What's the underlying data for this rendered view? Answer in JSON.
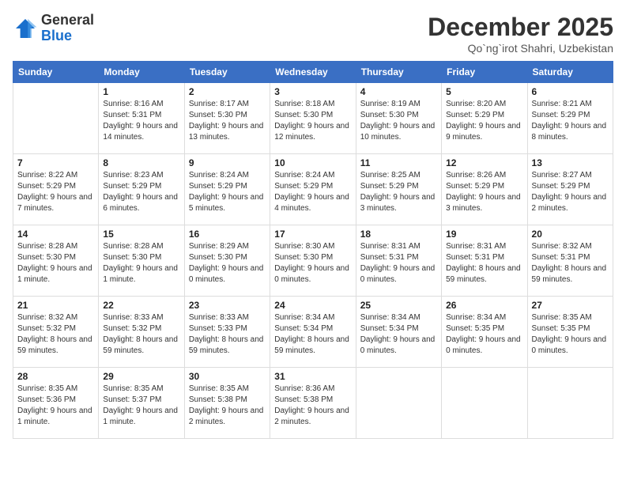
{
  "logo": {
    "general": "General",
    "blue": "Blue"
  },
  "header": {
    "month_year": "December 2025",
    "location": "Qo`ng`irot Shahri, Uzbekistan"
  },
  "weekdays": [
    "Sunday",
    "Monday",
    "Tuesday",
    "Wednesday",
    "Thursday",
    "Friday",
    "Saturday"
  ],
  "weeks": [
    [
      {
        "day": "",
        "sunrise": "",
        "sunset": "",
        "daylight": "",
        "empty": true
      },
      {
        "day": "1",
        "sunrise": "Sunrise: 8:16 AM",
        "sunset": "Sunset: 5:31 PM",
        "daylight": "Daylight: 9 hours and 14 minutes."
      },
      {
        "day": "2",
        "sunrise": "Sunrise: 8:17 AM",
        "sunset": "Sunset: 5:30 PM",
        "daylight": "Daylight: 9 hours and 13 minutes."
      },
      {
        "day": "3",
        "sunrise": "Sunrise: 8:18 AM",
        "sunset": "Sunset: 5:30 PM",
        "daylight": "Daylight: 9 hours and 12 minutes."
      },
      {
        "day": "4",
        "sunrise": "Sunrise: 8:19 AM",
        "sunset": "Sunset: 5:30 PM",
        "daylight": "Daylight: 9 hours and 10 minutes."
      },
      {
        "day": "5",
        "sunrise": "Sunrise: 8:20 AM",
        "sunset": "Sunset: 5:29 PM",
        "daylight": "Daylight: 9 hours and 9 minutes."
      },
      {
        "day": "6",
        "sunrise": "Sunrise: 8:21 AM",
        "sunset": "Sunset: 5:29 PM",
        "daylight": "Daylight: 9 hours and 8 minutes."
      }
    ],
    [
      {
        "day": "7",
        "sunrise": "Sunrise: 8:22 AM",
        "sunset": "Sunset: 5:29 PM",
        "daylight": "Daylight: 9 hours and 7 minutes."
      },
      {
        "day": "8",
        "sunrise": "Sunrise: 8:23 AM",
        "sunset": "Sunset: 5:29 PM",
        "daylight": "Daylight: 9 hours and 6 minutes."
      },
      {
        "day": "9",
        "sunrise": "Sunrise: 8:24 AM",
        "sunset": "Sunset: 5:29 PM",
        "daylight": "Daylight: 9 hours and 5 minutes."
      },
      {
        "day": "10",
        "sunrise": "Sunrise: 8:24 AM",
        "sunset": "Sunset: 5:29 PM",
        "daylight": "Daylight: 9 hours and 4 minutes."
      },
      {
        "day": "11",
        "sunrise": "Sunrise: 8:25 AM",
        "sunset": "Sunset: 5:29 PM",
        "daylight": "Daylight: 9 hours and 3 minutes."
      },
      {
        "day": "12",
        "sunrise": "Sunrise: 8:26 AM",
        "sunset": "Sunset: 5:29 PM",
        "daylight": "Daylight: 9 hours and 3 minutes."
      },
      {
        "day": "13",
        "sunrise": "Sunrise: 8:27 AM",
        "sunset": "Sunset: 5:29 PM",
        "daylight": "Daylight: 9 hours and 2 minutes."
      }
    ],
    [
      {
        "day": "14",
        "sunrise": "Sunrise: 8:28 AM",
        "sunset": "Sunset: 5:30 PM",
        "daylight": "Daylight: 9 hours and 1 minute."
      },
      {
        "day": "15",
        "sunrise": "Sunrise: 8:28 AM",
        "sunset": "Sunset: 5:30 PM",
        "daylight": "Daylight: 9 hours and 1 minute."
      },
      {
        "day": "16",
        "sunrise": "Sunrise: 8:29 AM",
        "sunset": "Sunset: 5:30 PM",
        "daylight": "Daylight: 9 hours and 0 minutes."
      },
      {
        "day": "17",
        "sunrise": "Sunrise: 8:30 AM",
        "sunset": "Sunset: 5:30 PM",
        "daylight": "Daylight: 9 hours and 0 minutes."
      },
      {
        "day": "18",
        "sunrise": "Sunrise: 8:31 AM",
        "sunset": "Sunset: 5:31 PM",
        "daylight": "Daylight: 9 hours and 0 minutes."
      },
      {
        "day": "19",
        "sunrise": "Sunrise: 8:31 AM",
        "sunset": "Sunset: 5:31 PM",
        "daylight": "Daylight: 8 hours and 59 minutes."
      },
      {
        "day": "20",
        "sunrise": "Sunrise: 8:32 AM",
        "sunset": "Sunset: 5:31 PM",
        "daylight": "Daylight: 8 hours and 59 minutes."
      }
    ],
    [
      {
        "day": "21",
        "sunrise": "Sunrise: 8:32 AM",
        "sunset": "Sunset: 5:32 PM",
        "daylight": "Daylight: 8 hours and 59 minutes."
      },
      {
        "day": "22",
        "sunrise": "Sunrise: 8:33 AM",
        "sunset": "Sunset: 5:32 PM",
        "daylight": "Daylight: 8 hours and 59 minutes."
      },
      {
        "day": "23",
        "sunrise": "Sunrise: 8:33 AM",
        "sunset": "Sunset: 5:33 PM",
        "daylight": "Daylight: 8 hours and 59 minutes."
      },
      {
        "day": "24",
        "sunrise": "Sunrise: 8:34 AM",
        "sunset": "Sunset: 5:34 PM",
        "daylight": "Daylight: 8 hours and 59 minutes."
      },
      {
        "day": "25",
        "sunrise": "Sunrise: 8:34 AM",
        "sunset": "Sunset: 5:34 PM",
        "daylight": "Daylight: 9 hours and 0 minutes."
      },
      {
        "day": "26",
        "sunrise": "Sunrise: 8:34 AM",
        "sunset": "Sunset: 5:35 PM",
        "daylight": "Daylight: 9 hours and 0 minutes."
      },
      {
        "day": "27",
        "sunrise": "Sunrise: 8:35 AM",
        "sunset": "Sunset: 5:35 PM",
        "daylight": "Daylight: 9 hours and 0 minutes."
      }
    ],
    [
      {
        "day": "28",
        "sunrise": "Sunrise: 8:35 AM",
        "sunset": "Sunset: 5:36 PM",
        "daylight": "Daylight: 9 hours and 1 minute."
      },
      {
        "day": "29",
        "sunrise": "Sunrise: 8:35 AM",
        "sunset": "Sunset: 5:37 PM",
        "daylight": "Daylight: 9 hours and 1 minute."
      },
      {
        "day": "30",
        "sunrise": "Sunrise: 8:35 AM",
        "sunset": "Sunset: 5:38 PM",
        "daylight": "Daylight: 9 hours and 2 minutes."
      },
      {
        "day": "31",
        "sunrise": "Sunrise: 8:36 AM",
        "sunset": "Sunset: 5:38 PM",
        "daylight": "Daylight: 9 hours and 2 minutes."
      },
      {
        "day": "",
        "sunrise": "",
        "sunset": "",
        "daylight": "",
        "empty": true
      },
      {
        "day": "",
        "sunrise": "",
        "sunset": "",
        "daylight": "",
        "empty": true
      },
      {
        "day": "",
        "sunrise": "",
        "sunset": "",
        "daylight": "",
        "empty": true
      }
    ]
  ]
}
